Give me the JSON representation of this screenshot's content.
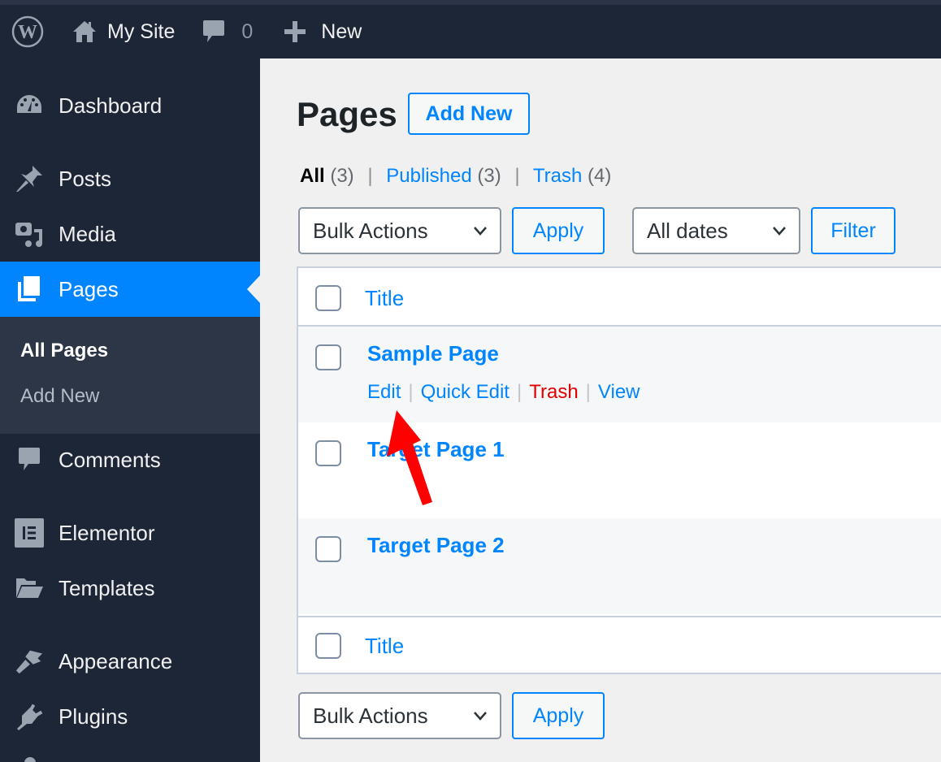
{
  "admin_bar": {
    "site_name": "My Site",
    "comments_count": "0",
    "new_label": "New"
  },
  "sidebar": {
    "items": [
      {
        "label": "Dashboard",
        "icon": "dashboard-icon"
      },
      {
        "label": "Posts",
        "icon": "pin-icon"
      },
      {
        "label": "Media",
        "icon": "media-icon"
      },
      {
        "label": "Pages",
        "icon": "pages-icon",
        "current": true
      },
      {
        "label": "Comments",
        "icon": "comment-icon"
      },
      {
        "label": "Elementor",
        "icon": "elementor-icon"
      },
      {
        "label": "Templates",
        "icon": "folder-icon"
      },
      {
        "label": "Appearance",
        "icon": "paintbrush-icon"
      },
      {
        "label": "Plugins",
        "icon": "plugin-icon"
      }
    ],
    "submenu": [
      {
        "label": "All Pages",
        "active": true
      },
      {
        "label": "Add New",
        "active": false
      }
    ]
  },
  "main": {
    "title": "Pages",
    "add_new_label": "Add New",
    "views": {
      "all_label": "All",
      "all_count": "(3)",
      "published_label": "Published",
      "published_count": "(3)",
      "trash_label": "Trash",
      "trash_count": "(4)",
      "separator": "|"
    },
    "bulk_actions_selected": "Bulk Actions",
    "apply_label": "Apply",
    "dates_selected": "All dates",
    "filter_label": "Filter",
    "table": {
      "column_header": "Title",
      "rows": [
        {
          "title": "Sample Page",
          "actions": [
            "Edit",
            "Quick Edit",
            "Trash",
            "View"
          ]
        },
        {
          "title": "Target Page 1"
        },
        {
          "title": "Target Page 2"
        }
      ],
      "separator": "|"
    }
  },
  "colors": {
    "accent": "#0085ff",
    "sidebar_bg": "#1d2636",
    "trash_red": "#e10000",
    "annotation_arrow": "#ff0000"
  }
}
